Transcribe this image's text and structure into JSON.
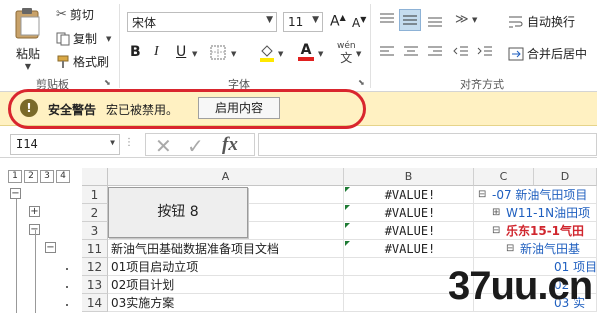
{
  "clipboard": {
    "paste": "粘贴",
    "cut": "剪切",
    "copy": "复制",
    "format_painter": "格式刷",
    "group_label": "剪贴板"
  },
  "font": {
    "name": "宋体",
    "size": "11",
    "grow": "A",
    "shrink": "A",
    "bold": "B",
    "italic": "I",
    "underline": "U",
    "font_color": "A",
    "phonetic": "wén",
    "group_label": "字体"
  },
  "alignment": {
    "wrap_text": "自动换行",
    "merge_center": "合并后居中",
    "group_label": "对齐方式"
  },
  "security": {
    "title": "安全警告",
    "message": "宏已被禁用。",
    "enable_button": "启用内容"
  },
  "formula_bar": {
    "name_box": "I14",
    "fx": "fx",
    "value": ""
  },
  "outline_levels": [
    "1",
    "2",
    "3",
    "4"
  ],
  "columns": [
    "A",
    "B",
    "C",
    "D"
  ],
  "rows": [
    {
      "num": "1",
      "a": "",
      "b": "#VALUE!",
      "c": "-07 新油气田项目"
    },
    {
      "num": "2",
      "a": "",
      "b": "#VALUE!",
      "c": "W11-1N油田项"
    },
    {
      "num": "3",
      "a": "",
      "b": "#VALUE!",
      "c": "乐东15-1气田"
    },
    {
      "num": "11",
      "a": "新油气田基础数据准备项目文档",
      "b": "#VALUE!",
      "c": "新油气田基"
    },
    {
      "num": "12",
      "a": "01项目启动立项",
      "b": "",
      "c": "01 项目"
    },
    {
      "num": "13",
      "a": "02项目计划",
      "b": "",
      "c": "02"
    },
    {
      "num": "14",
      "a": "03实施方案",
      "b": "",
      "c": "03 实"
    }
  ],
  "floating_button": {
    "label": "按钮 8"
  },
  "watermark": {
    "text": "37uu.cn"
  },
  "colors": {
    "security_bar": "#fff1c2",
    "annotation_ring": "#d9262e",
    "error_tri": "#1e7b34",
    "link_blue": "#1f5fbf",
    "red_text": "#d0262e"
  }
}
